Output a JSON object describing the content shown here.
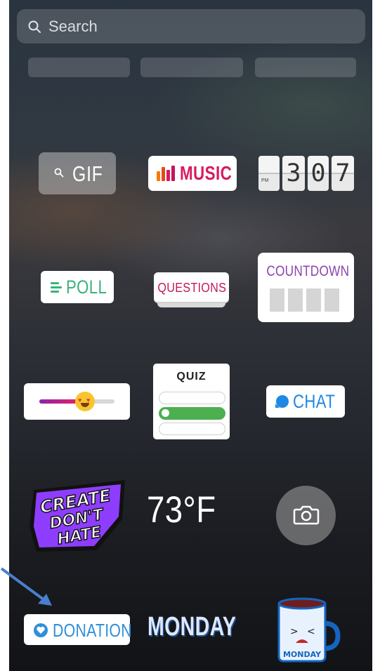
{
  "search": {
    "placeholder": "Search"
  },
  "stickers": {
    "gif": "GIF",
    "music": "MUSIC",
    "clock": {
      "period": "PM",
      "digits": [
        "3",
        "0",
        "7"
      ]
    },
    "poll": "POLL",
    "questions": "QUESTIONS",
    "countdown": "COUNTDOWN",
    "quiz": "QUIZ",
    "chat": "CHAT",
    "create": [
      "CREATE",
      "DON'T",
      "HATE"
    ],
    "temperature": "73°F",
    "donation": "DONATION",
    "monday": "MONDAY",
    "mug_text": "MONDAY"
  },
  "colors": {
    "music": "#d81b60",
    "poll": "#3ab27a",
    "questions": "#c2185b",
    "countdown": "#8e44ad",
    "chat": "#1e88e5",
    "donation": "#2f8fd8",
    "arrow": "#4a7fd0"
  },
  "icons": {
    "search": "search-icon",
    "camera": "camera-icon",
    "arrow": "arrow-pointer"
  }
}
